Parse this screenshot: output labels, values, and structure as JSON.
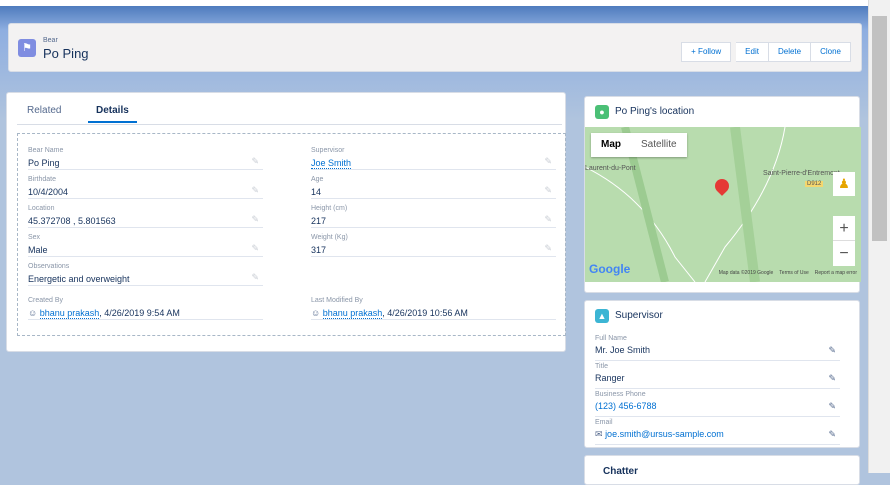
{
  "header": {
    "object_type": "Bear",
    "title": "Po Ping",
    "buttons": {
      "follow": "+ Follow",
      "edit": "Edit",
      "delete": "Delete",
      "clone": "Clone"
    }
  },
  "tabs": {
    "related": "Related",
    "details": "Details"
  },
  "fields": [
    {
      "label": "Bear Name",
      "value": "Po Ping"
    },
    {
      "label": "Supervisor",
      "value": "Joe Smith",
      "link": true
    },
    {
      "label": "Birthdate",
      "value": "10/4/2004"
    },
    {
      "label": "Age",
      "value": "14"
    },
    {
      "label": "Location",
      "value": "45.372708 , 5.801563"
    },
    {
      "label": "Height (cm)",
      "value": "217"
    },
    {
      "label": "Sex",
      "value": "Male"
    },
    {
      "label": "Weight (Kg)",
      "value": "317"
    },
    {
      "label": "Observations",
      "value": "Energetic and overweight"
    }
  ],
  "created": {
    "label": "Created By",
    "user": "bhanu prakash",
    "date": ", 4/26/2019 9:54 AM"
  },
  "modified": {
    "label": "Last Modified By",
    "user": "bhanu prakash",
    "date": ", 4/26/2019 10:56 AM"
  },
  "map": {
    "title": "Po Ping's location",
    "map_btn": "Map",
    "satellite_btn": "Satellite",
    "place1": "Laurent-du-Pont",
    "place2": "Saint-Pierre-d'Entremont",
    "road": "D912",
    "logo": "Google",
    "attribution": "Map data ©2019 Google",
    "terms": "Terms of Use",
    "report": "Report a map error",
    "zoom_in": "+",
    "zoom_out": "−"
  },
  "supervisor": {
    "title": "Supervisor",
    "fields": [
      {
        "label": "Full Name",
        "value": "Mr. Joe Smith"
      },
      {
        "label": "Title",
        "value": "Ranger"
      },
      {
        "label": "Business Phone",
        "value": "(123) 456-6788"
      },
      {
        "label": "Email",
        "value": "joe.smith@ursus-sample.com"
      }
    ]
  },
  "chatter": {
    "title": "Chatter"
  }
}
